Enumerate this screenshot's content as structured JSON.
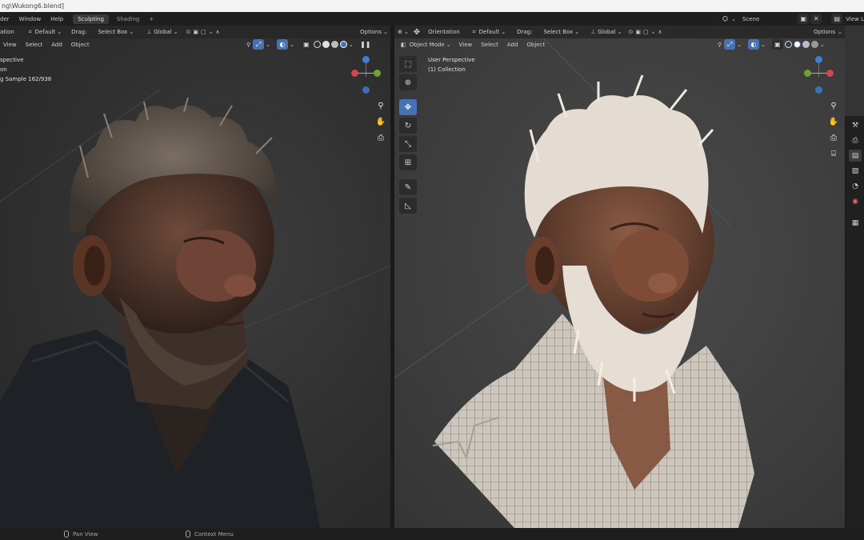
{
  "window": {
    "title_path": "ng\\Wukong6.blend]"
  },
  "topbar": {
    "menu": [
      "der",
      "Window",
      "Help"
    ],
    "tabs": [
      "Sculpting",
      "Shading"
    ],
    "add_tab": "+",
    "scene_label": "Scene",
    "view_layer_label": "View L"
  },
  "left_viewport": {
    "header": {
      "mode_label": "ation",
      "orientation_value": "Default",
      "drag_label": "Drag:",
      "drag_value": "Select Box",
      "transform_value": "Global",
      "options_label": "Options"
    },
    "menu": [
      "View",
      "Select",
      "Add",
      "Object"
    ],
    "overlay_lines": [
      "spective",
      "on",
      "g Sample 162/938"
    ]
  },
  "right_viewport": {
    "header": {
      "orientation_label": "Orientation",
      "orientation_value": "Default",
      "drag_label": "Drag:",
      "drag_value": "Select Box",
      "transform_value": "Global",
      "options_label": "Options"
    },
    "mode_value": "Object Mode",
    "menu": [
      "View",
      "Select",
      "Add",
      "Object"
    ],
    "overlay_lines": [
      "User Perspective",
      "(1) Collection"
    ]
  },
  "statusbar": {
    "pan_label": "Pan View",
    "context_label": "Context Menu"
  },
  "colors": {
    "accent": "#4772b3",
    "gizmo_x": "#d6444e",
    "gizmo_y": "#6ea234",
    "gizmo_z": "#3d7fd6"
  }
}
